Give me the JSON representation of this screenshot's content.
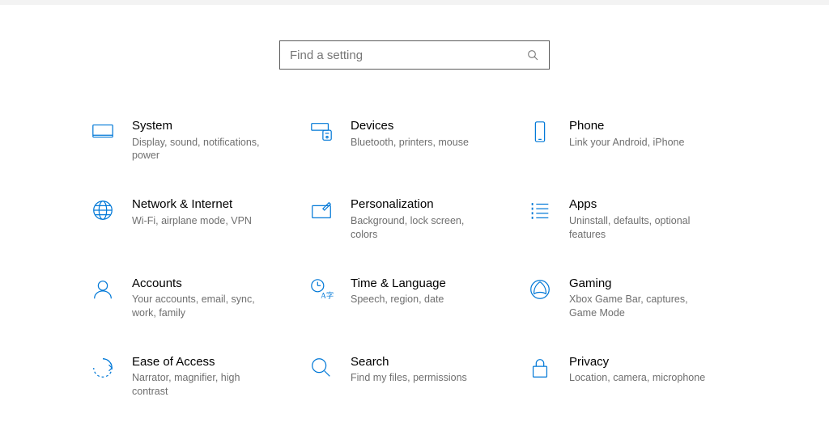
{
  "search": {
    "placeholder": "Find a setting"
  },
  "tiles": [
    {
      "title": "System",
      "sub": "Display, sound, notifications, power"
    },
    {
      "title": "Devices",
      "sub": "Bluetooth, printers, mouse"
    },
    {
      "title": "Phone",
      "sub": "Link your Android, iPhone"
    },
    {
      "title": "Network & Internet",
      "sub": "Wi-Fi, airplane mode, VPN"
    },
    {
      "title": "Personalization",
      "sub": "Background, lock screen, colors"
    },
    {
      "title": "Apps",
      "sub": "Uninstall, defaults, optional features"
    },
    {
      "title": "Accounts",
      "sub": "Your accounts, email, sync, work, family"
    },
    {
      "title": "Time & Language",
      "sub": "Speech, region, date"
    },
    {
      "title": "Gaming",
      "sub": "Xbox Game Bar, captures, Game Mode"
    },
    {
      "title": "Ease of Access",
      "sub": "Narrator, magnifier, high contrast"
    },
    {
      "title": "Search",
      "sub": "Find my files, permissions"
    },
    {
      "title": "Privacy",
      "sub": "Location, camera, microphone"
    }
  ]
}
